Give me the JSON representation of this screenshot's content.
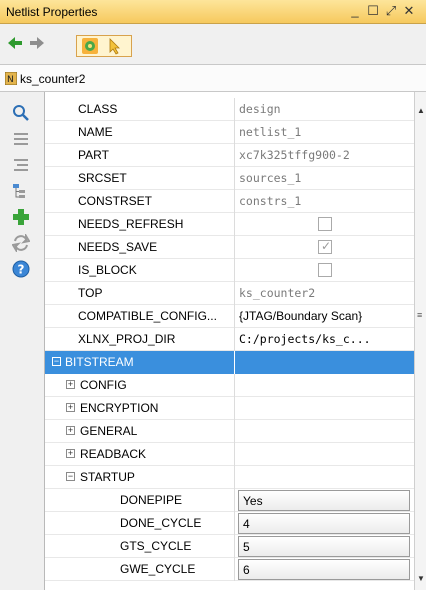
{
  "window": {
    "title": "Netlist Properties",
    "controls": [
      "_",
      "☐",
      "⤢",
      "✕"
    ]
  },
  "toolbar": {
    "buttons": [
      "back-arrow-icon",
      "forward-arrow-icon",
      "properties-icon",
      "select-pointer-icon"
    ]
  },
  "object": {
    "name": "ks_counter2",
    "icon": "netlist-icon"
  },
  "sidebar": {
    "icons": [
      "search-icon",
      "collapse-all-icon",
      "expand-all-icon",
      "group-icon",
      "add-property-icon",
      "refresh-icon",
      "help-icon"
    ]
  },
  "properties": [
    {
      "name": "CLASS",
      "value": "design"
    },
    {
      "name": "NAME",
      "value": "netlist_1"
    },
    {
      "name": "PART",
      "value": "xc7k325tffg900-2"
    },
    {
      "name": "SRCSET",
      "value": "sources_1"
    },
    {
      "name": "CONSTRSET",
      "value": "constrs_1"
    },
    {
      "name": "NEEDS_REFRESH",
      "checked": false
    },
    {
      "name": "NEEDS_SAVE",
      "checked": true
    },
    {
      "name": "IS_BLOCK",
      "checked": false
    },
    {
      "name": "TOP",
      "value": "ks_counter2"
    },
    {
      "name": "COMPATIBLE_CONFIG...",
      "value": "{JTAG/Boundary Scan}"
    },
    {
      "name": "XLNX_PROJ_DIR",
      "value": "C:/projects/ks_c..."
    }
  ],
  "bitstream": {
    "label": "BITSTREAM",
    "groups": [
      "CONFIG",
      "ENCRYPTION",
      "GENERAL",
      "READBACK"
    ],
    "startup": {
      "label": "STARTUP",
      "items": [
        {
          "name": "DONEPIPE",
          "value": "Yes"
        },
        {
          "name": "DONE_CYCLE",
          "value": "4"
        },
        {
          "name": "GTS_CYCLE",
          "value": "5"
        },
        {
          "name": "GWE_CYCLE",
          "value": "6"
        }
      ]
    }
  },
  "colors": {
    "title_bar": "#f6c95e",
    "selected_row": "#3a8fdd"
  }
}
